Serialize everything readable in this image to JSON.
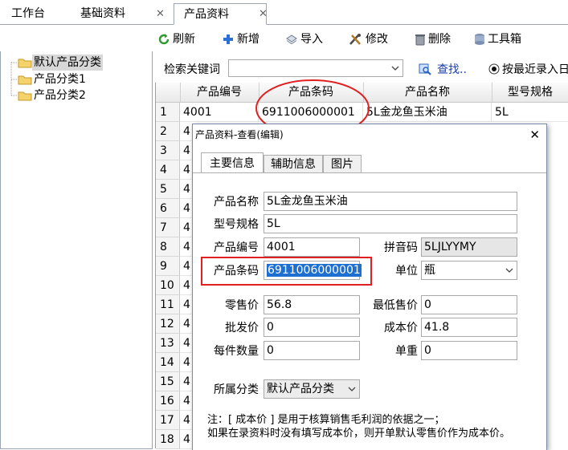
{
  "tabs": [
    {
      "label": "工作台"
    },
    {
      "label": "基础资料"
    },
    {
      "label": "产品资料"
    }
  ],
  "close_glyph": "✕",
  "toolbar": {
    "refresh": "刷新",
    "add": "新增",
    "import": "导入",
    "edit": "修改",
    "delete": "删除",
    "tools": "工具箱"
  },
  "tree": {
    "items": [
      {
        "label": "默认产品分类"
      },
      {
        "label": "产品分类1"
      },
      {
        "label": "产品分类2"
      }
    ]
  },
  "search": {
    "label": "检索关键词",
    "value": "",
    "find": "查找..",
    "radio_label": "按最近录入日"
  },
  "grid": {
    "headers": [
      "产品编号",
      "产品条码",
      "产品名称",
      "型号规格"
    ],
    "rownums": [
      "1",
      "2",
      "3",
      "4",
      "5",
      "6",
      "7",
      "8",
      "9",
      "10",
      "11",
      "12",
      "13",
      "14",
      "15",
      "16",
      "17",
      "18"
    ],
    "first_row": {
      "code": "4001",
      "barcode": "6911006000001",
      "name": "5L金龙鱼玉米油",
      "spec": "5L"
    },
    "col1_partial": "4"
  },
  "dialog": {
    "title": "产品资料-查看(编辑)",
    "close": "✕",
    "tabs": [
      "主要信息",
      "辅助信息",
      "图片"
    ],
    "labels": {
      "name": "产品名称",
      "spec": "型号规格",
      "code": "产品编号",
      "pinyin": "拼音码",
      "barcode": "产品条码",
      "unit": "单位",
      "retail": "零售价",
      "min_price": "最低售价",
      "wholesale": "批发价",
      "cost": "成本价",
      "per_qty": "每件数量",
      "weight": "单重",
      "category": "所属分类"
    },
    "values": {
      "name": "5L金龙鱼玉米油",
      "spec": "5L",
      "code": "4001",
      "pinyin": "5LJLYYMY",
      "barcode": "6911006000001",
      "unit": "瓶",
      "retail": "56.8",
      "min_price": "0",
      "wholesale": "0",
      "cost": "41.8",
      "per_qty": "0",
      "weight": "0",
      "category": "默认产品分类"
    },
    "note_line1": "注：[ 成本价 ] 是用于核算销售毛利润的依据之一；",
    "note_line2": "如果在录资料时没有填写成本价，则开单默认零售价作为成本价。"
  },
  "colors": {
    "highlight": "#1d6fd0",
    "annotation_red": "#e02020"
  }
}
